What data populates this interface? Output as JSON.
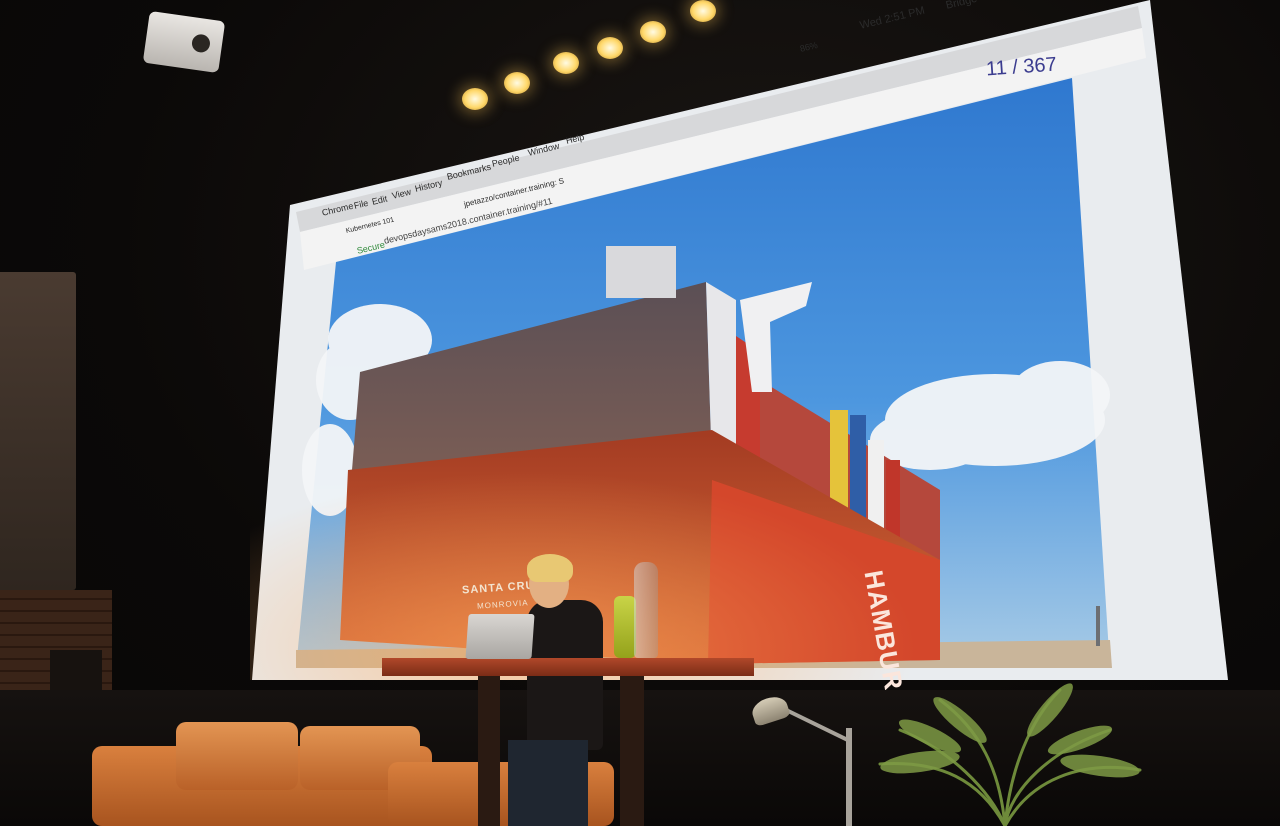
{
  "browser": {
    "app_menu": [
      "Chrome",
      "File",
      "Edit",
      "View",
      "History",
      "Bookmarks",
      "People",
      "Window",
      "Help"
    ],
    "tabs": [
      "Kubernetes 101",
      "jpetazzo/container.training: S"
    ],
    "secure_label": "Secure",
    "url": "devopsdaysams2018.container.training/#11",
    "status_clock": "Wed 2:51 PM",
    "status_battery": "86%",
    "status_user": "Bridge"
  },
  "slide": {
    "counter": "11 / 367"
  },
  "ship": {
    "name": "SANTA CRU",
    "port": "MONROVIA",
    "hull_text": "HAMBURG SÜD"
  },
  "colors": {
    "sky": "#3a83d6",
    "hull": "#c94e2b",
    "slide_counter": "#3b3c8f",
    "sofa": "#d07434"
  }
}
